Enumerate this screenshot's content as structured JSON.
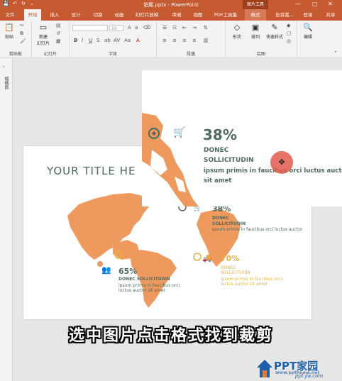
{
  "window": {
    "title": "铂尾.pptx - PowerPoint",
    "context_tab_group": "图片工具",
    "controls": [
      "—",
      "▢",
      "✕"
    ]
  },
  "quick_access": [
    "save-icon",
    "undo-icon",
    "redo-icon",
    "customize-icon"
  ],
  "tabs": {
    "file": "文件",
    "home": "开始",
    "insert": "插入",
    "design": "设计",
    "transitions": "切换",
    "animations": "动画",
    "slideshow": "幻灯片放映",
    "review": "审阅",
    "view": "视图",
    "pdf": "PDF工具集",
    "format": "格式",
    "tell": "告诉我...",
    "login": "登录",
    "share": "共享"
  },
  "ribbon": {
    "clipboard": {
      "paste": "粘贴",
      "label": "剪贴板"
    },
    "slides": {
      "new_slide": "新建",
      "new_slide2": "幻灯片",
      "label": "幻灯片"
    },
    "font": {
      "name_value": "",
      "size_value": "16",
      "label": "字体"
    },
    "paragraph": {
      "label": "段落"
    },
    "drawing": {
      "shape": "形状",
      "arrange": "排列",
      "quick_styles": "快速样式",
      "label": "绘图"
    },
    "editing": {
      "edit": "编辑"
    }
  },
  "left_panel": {
    "label": "缩略图"
  },
  "slide": {
    "title": "YOUR TITLE HE",
    "stat_a": {
      "value": "38%",
      "head1": "DONEC",
      "head2": "SOLLICITUDIN",
      "body": "ipsum primis in faucibus orci luctus auctor"
    },
    "stat_b": {
      "value": "65%",
      "head": "DONEC SOLLICITUDIN",
      "body1": "ipsum primis in faucibus orci",
      "body2": "luctus auctor sit amet"
    },
    "stat_c": {
      "value": "70%",
      "head1": "DONEC",
      "head2": "SOLLICITUDIN",
      "body1": "ipsum primis in faucibus orci",
      "body2": "luctus auctor sit amet"
    }
  },
  "floating_image": {
    "value": "38%",
    "head1": "DONEC",
    "head2": "SOLLICITUDIN",
    "body1": "ipsum primis in faucibus orci luctus auctor",
    "body2": "sit amet"
  },
  "cursor_glyph": "✥",
  "subtitle": "选中图片点击格式找到裁剪",
  "watermark": {
    "brand": "PPT家园",
    "site": "www.ppthome.net",
    "domain": "ppt jia.com"
  },
  "colors": {
    "accent": "#c65a30",
    "map": "#ee9a5e",
    "teal": "#4e6a5f",
    "gold": "#e5b13a"
  }
}
